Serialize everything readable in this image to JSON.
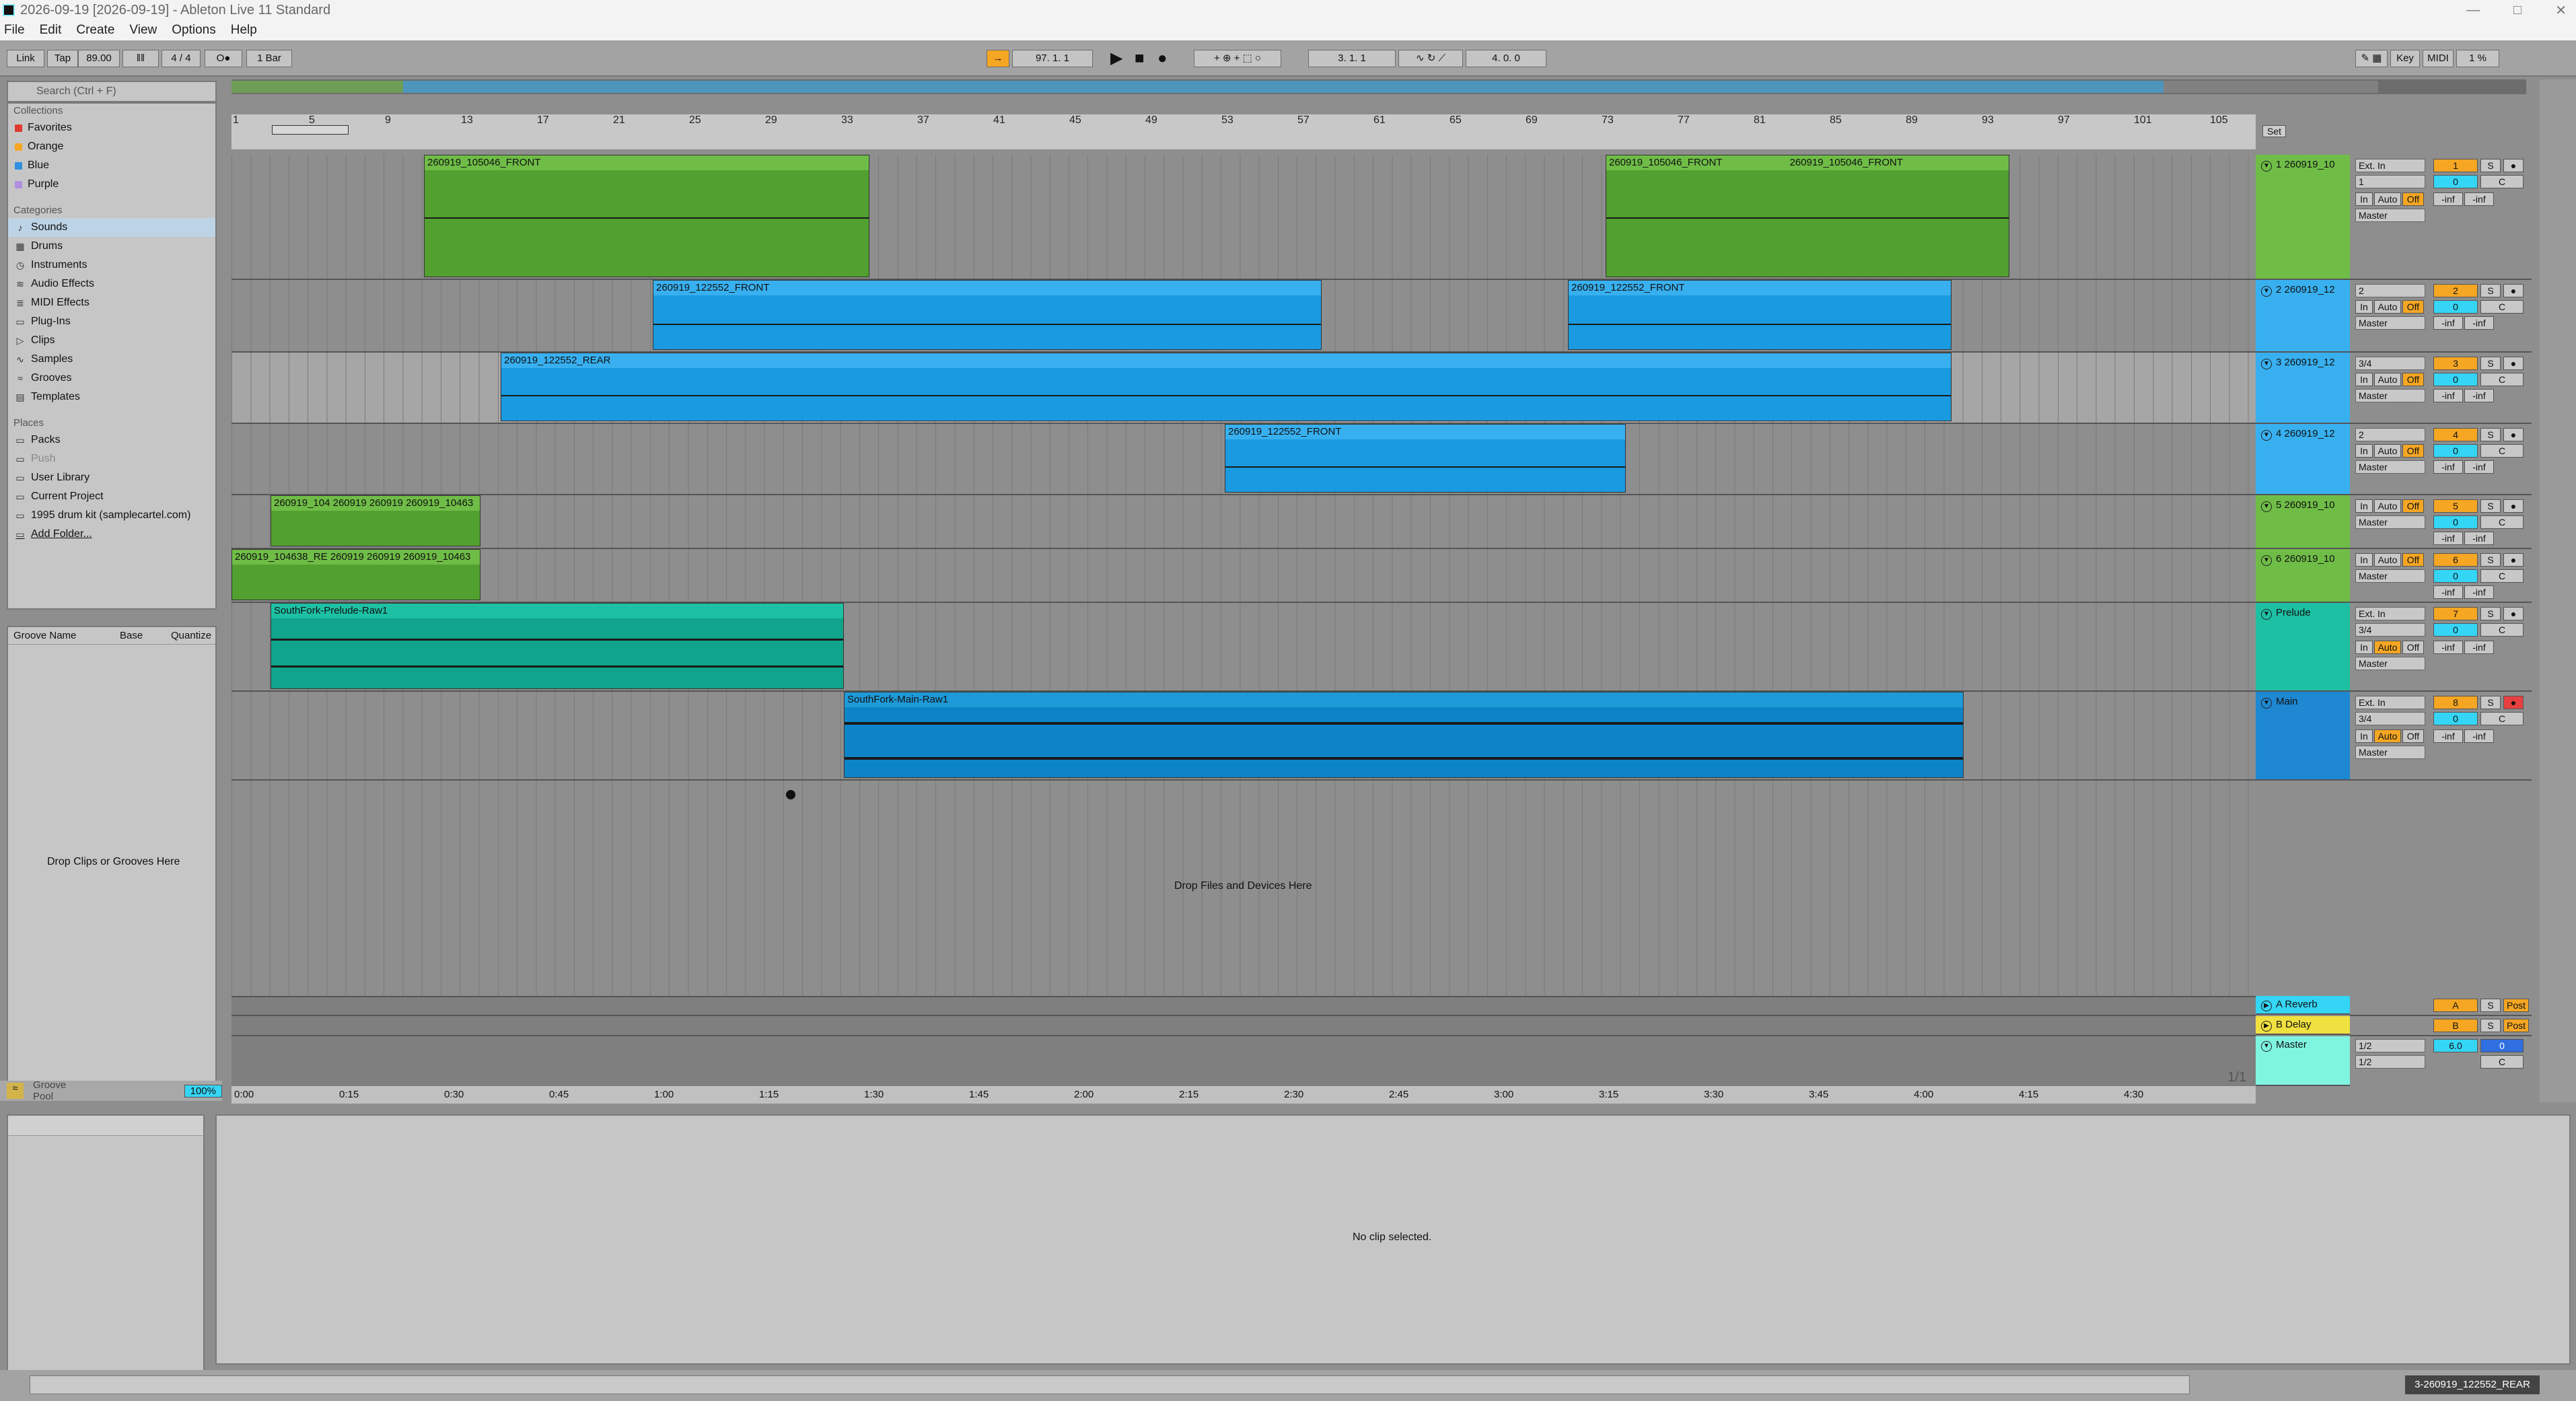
{
  "window": {
    "title": "2026-09-19  [2026-09-19] - Ableton Live 11 Standard",
    "minimize": "—",
    "maximize": "□",
    "close": "✕"
  },
  "menu": [
    "File",
    "Edit",
    "Create",
    "View",
    "Options",
    "Help"
  ],
  "control": {
    "link": "Link",
    "tap": "Tap",
    "tempo": "89.00",
    "signature": "4 / 4",
    "metro": "O●",
    "quantize": "1 Bar",
    "position": "97.  1.  1",
    "loop_start": "3.  1.  1",
    "loop_length": "4.  0.  0",
    "key": "Key",
    "midi": "MIDI",
    "cpu": "1 %"
  },
  "browser": {
    "search_placeholder": "Search (Ctrl + F)",
    "collections_header": "Collections",
    "collections": [
      {
        "label": "Favorites",
        "color": "#e03a2f"
      },
      {
        "label": "Orange",
        "color": "#f5a623"
      },
      {
        "label": "Blue",
        "color": "#2f8fe0"
      },
      {
        "label": "Purple",
        "color": "#b08ee0"
      }
    ],
    "categories_header": "Categories",
    "categories": [
      {
        "label": "Sounds",
        "icon": "♪"
      },
      {
        "label": "Drums",
        "icon": "▦"
      },
      {
        "label": "Instruments",
        "icon": "◷"
      },
      {
        "label": "Audio Effects",
        "icon": "≋"
      },
      {
        "label": "MIDI Effects",
        "icon": "≣"
      },
      {
        "label": "Plug-Ins",
        "icon": "▭"
      },
      {
        "label": "Clips",
        "icon": "▷"
      },
      {
        "label": "Samples",
        "icon": "∿"
      },
      {
        "label": "Grooves",
        "icon": "≈"
      },
      {
        "label": "Templates",
        "icon": "▤"
      }
    ],
    "places_header": "Places",
    "places": [
      "Packs",
      "Push",
      "User Library",
      "Current Project",
      "1995 drum kit (samplecartel.com)",
      "Add Folder..."
    ]
  },
  "groove": {
    "col_name": "Groove Name",
    "col_base": "Base",
    "col_quantize": "Quantize",
    "drop_text": "Drop Clips or Grooves Here",
    "footer": "Groove Pool",
    "footer_value": "100%"
  },
  "ruler": [
    "1",
    "5",
    "9",
    "13",
    "17",
    "21",
    "25",
    "29",
    "33",
    "37",
    "41",
    "45",
    "49",
    "53",
    "57",
    "61",
    "65",
    "69",
    "73",
    "77",
    "81",
    "85",
    "89",
    "93",
    "97",
    "101",
    "105"
  ],
  "clips": {
    "t1a": "260919_105046_FRONT",
    "t1b": "260919_105046_FRONT",
    "t1c": "260919_105046_FRONT",
    "t2a": "260919_122552_FRONT",
    "t2b": "260919_122552_FRONT",
    "t3a": "260919_122552_REAR",
    "t4a": "260919_122552_FRONT",
    "t5a": "260919_104",
    "t5b": "260919",
    "t5c": "260919",
    "t5d": "260919_10463",
    "t6a": "260919_104638_RE",
    "t6b": "260919",
    "t6c": "260919",
    "t6d": "260919_10463",
    "t7a": "SouthFork-Prelude-Raw1",
    "t8a": "SouthFork-Main-Raw1"
  },
  "drop_files": "Drop Files and Devices Here",
  "tracks": [
    {
      "name": "1 260919_10",
      "color": "green",
      "num": "1",
      "input": "Ext. In",
      "ch": "1"
    },
    {
      "name": "2 260919_12",
      "color": "blue",
      "num": "2",
      "input": "2",
      "ch": ""
    },
    {
      "name": "3 260919_12",
      "color": "blue",
      "num": "3",
      "input": "3/4",
      "ch": ""
    },
    {
      "name": "4 260919_12",
      "color": "blue",
      "num": "4",
      "input": "2",
      "ch": ""
    },
    {
      "name": "5 260919_10",
      "color": "green",
      "num": "5",
      "input": "",
      "ch": ""
    },
    {
      "name": "6 260919_10",
      "color": "green",
      "num": "6",
      "input": "",
      "ch": ""
    },
    {
      "name": "Prelude",
      "color": "teal",
      "num": "7",
      "input": "Ext. In",
      "ch": "3/4"
    },
    {
      "name": "Main",
      "color": "dblue",
      "num": "8",
      "input": "Ext. In",
      "ch": "3/4"
    }
  ],
  "mixer_labels": {
    "in": "In",
    "auto": "Auto",
    "off": "Off",
    "master": "Master",
    "zero": "0",
    "c": "C",
    "inf": "-inf",
    "s": "S",
    "post": "Post"
  },
  "returns": [
    {
      "name": "A Reverb",
      "letter": "A"
    },
    {
      "name": "B Delay",
      "letter": "B"
    },
    {
      "name": "Master",
      "letter": "0"
    }
  ],
  "master": {
    "in1": "1/2",
    "in2": "1/2",
    "vol": "6.0"
  },
  "timeline": [
    "0:00",
    "0:15",
    "0:30",
    "0:45",
    "1:00",
    "1:15",
    "1:30",
    "1:45",
    "2:00",
    "2:15",
    "2:30",
    "2:45",
    "3:00",
    "3:15",
    "3:30",
    "3:45",
    "4:00",
    "4:15",
    "4:30"
  ],
  "page_indicator": "1/1",
  "set_label": "Set",
  "no_clip": "No clip selected.",
  "status": {
    "track": "3-260919_122552_REAR"
  }
}
